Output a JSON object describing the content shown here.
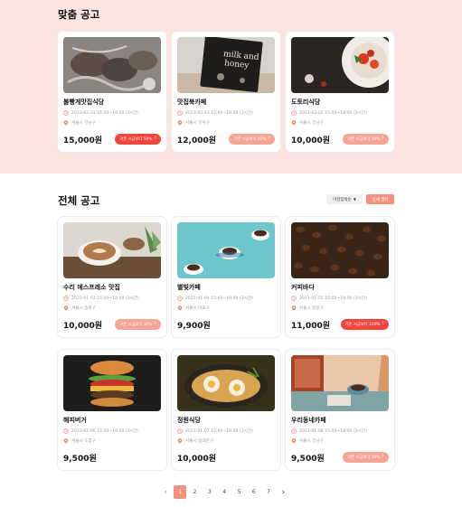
{
  "sections": {
    "recommended_title": "맞춤 공고",
    "all_title": "전체 공고"
  },
  "controls": {
    "sort_label": "마감임박순",
    "filter_label": "상세 필터"
  },
  "recommended_cards": [
    {
      "name": "불빵게맛집식당",
      "time": "2023-02-31 15:00~18:00 (3시간)",
      "location": "서울시 강남구",
      "price": "15,000원",
      "badge": "기존 시급보다 50%",
      "badge_style": "strong",
      "image": "seafood"
    },
    {
      "name": "맛집북카페",
      "time": "2023-02-13 15:00~18:00 (3시간)",
      "location": "서울시 강서구",
      "price": "12,000원",
      "badge": "기존 시급보다 20%",
      "badge_style": "light",
      "image": "book"
    },
    {
      "name": "도토리식당",
      "time": "2023-03-02 15:00~18:00 (3시간)",
      "location": "서울시 강남구",
      "price": "10,000원",
      "badge": "기존 시급보다 10%",
      "badge_style": "light",
      "image": "pasta"
    }
  ],
  "all_cards": [
    {
      "name": "수리 에스프레소 맛집",
      "time": "2023-01-03 15:00~18:00 (3시간)",
      "location": "서울시 송파구",
      "price": "10,000원",
      "badge": "기존 시급보다 30%",
      "badge_style": "light",
      "image": "latte"
    },
    {
      "name": "별빛카페",
      "time": "2023-01-04 15:00~18:00 (3시간)",
      "location": "서울시 마포구",
      "price": "9,900원",
      "badge": "",
      "badge_style": "",
      "image": "cups"
    },
    {
      "name": "커피바다",
      "time": "2023-01-05 15:00~18:00 (3시간)",
      "location": "서울시 중랑구",
      "price": "11,000원",
      "badge": "기존 시급보다 100%",
      "badge_style": "strong",
      "image": "beans"
    },
    {
      "name": "해피버거",
      "time": "2023-01-06 15:00~18:00 (3시간)",
      "location": "서울시 도봉구",
      "price": "9,500원",
      "badge": "",
      "badge_style": "",
      "image": "burger"
    },
    {
      "name": "정원식당",
      "time": "2023-01-07 15:00~18:00 (3시간)",
      "location": "서울시 동대문구",
      "price": "10,000원",
      "badge": "",
      "badge_style": "",
      "image": "ramen"
    },
    {
      "name": "우리동네카페",
      "time": "2023-01-08 15:00~18:00 (3시간)",
      "location": "서울시 강남구",
      "price": "9,500원",
      "badge": "기존 시급보다 10%",
      "badge_style": "light",
      "image": "cafe"
    }
  ],
  "pagination": {
    "prev": "‹",
    "next": "›",
    "pages": [
      "1",
      "2",
      "3",
      "4",
      "5",
      "6",
      "7"
    ],
    "current": "1"
  },
  "icons": {
    "time": "clock-icon",
    "location": "map-pin-icon",
    "badge_arrow": "arrow-up-icon",
    "sort_arrow": "caret-down-icon"
  },
  "colors": {
    "top_background": "#fde4e1",
    "accent": "#f1463c",
    "accent_light": "#f5a593",
    "page_active": "#f5917d"
  }
}
